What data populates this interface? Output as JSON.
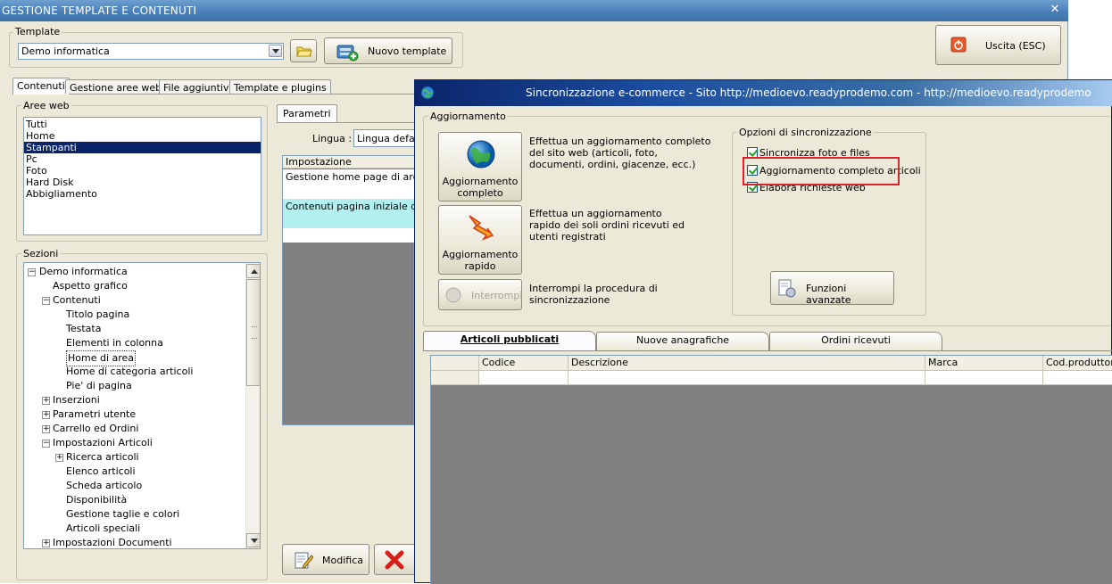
{
  "main_window": {
    "title": "GESTIONE TEMPLATE E CONTENUTI",
    "close_glyph": "✕"
  },
  "template_group": {
    "legend": "Template",
    "selected_template": "Demo informatica",
    "new_template_label": "Nuovo template"
  },
  "exit_button": {
    "label": "Uscita (ESC)"
  },
  "main_tabs": [
    "Contenuti",
    "Gestione aree web",
    "File aggiuntivi",
    "Template e plugins"
  ],
  "aree_web": {
    "legend": "Aree web",
    "items": [
      "Tutti",
      "Home",
      "Stampanti",
      "Pc",
      "Foto",
      "Hard Disk",
      "Abbigliamento"
    ],
    "selected": "Stampanti"
  },
  "sezioni": {
    "legend": "Sezioni",
    "tree": [
      {
        "label": "Demo informatica",
        "level": 0,
        "expander": "−"
      },
      {
        "label": "Aspetto grafico",
        "level": 1,
        "expander": ""
      },
      {
        "label": "Contenuti",
        "level": 1,
        "expander": "−"
      },
      {
        "label": "Titolo pagina",
        "level": 2,
        "expander": ""
      },
      {
        "label": "Testata",
        "level": 2,
        "expander": ""
      },
      {
        "label": "Elementi in colonna",
        "level": 2,
        "expander": ""
      },
      {
        "label": "Home di area",
        "level": 2,
        "expander": "",
        "selected": true
      },
      {
        "label": "Home di categoria articoli",
        "level": 2,
        "expander": ""
      },
      {
        "label": "Pie' di pagina",
        "level": 2,
        "expander": ""
      },
      {
        "label": "Inserzioni",
        "level": 1,
        "expander": "+"
      },
      {
        "label": "Parametri utente",
        "level": 1,
        "expander": "+"
      },
      {
        "label": "Carrello ed Ordini",
        "level": 1,
        "expander": "+"
      },
      {
        "label": "Impostazioni Articoli",
        "level": 1,
        "expander": "−"
      },
      {
        "label": "Ricerca articoli",
        "level": 2,
        "expander": "+"
      },
      {
        "label": "Elenco articoli",
        "level": 2,
        "expander": ""
      },
      {
        "label": "Scheda articolo",
        "level": 2,
        "expander": ""
      },
      {
        "label": "Disponibilità",
        "level": 2,
        "expander": ""
      },
      {
        "label": "Gestione taglie e colori",
        "level": 2,
        "expander": ""
      },
      {
        "label": "Articoli speciali",
        "level": 2,
        "expander": ""
      },
      {
        "label": "Impostazioni Documenti",
        "level": 1,
        "expander": "+"
      }
    ]
  },
  "parametri": {
    "tab_label": "Parametri",
    "lingua_label": "Lingua :",
    "lingua_value": "Lingua defau",
    "grid_header": "Impostazione",
    "rows": [
      "Gestione home page di area",
      "Contenuti pagina iniziale di are"
    ]
  },
  "bottom_buttons": {
    "modifica_label": "Modifica"
  },
  "sync_dialog": {
    "title": "Sincronizzazione e-commerce - Sito http://medioevo.readyprodemo.com - http://medioevo.readyprodemo",
    "aggiornamento_legend": "Aggiornamento",
    "btn_completo": [
      "Aggiornamento",
      "completo"
    ],
    "desc_completo": [
      "Effettua un aggiornamento completo",
      "del sito web (articoli, foto,",
      "documenti, ordini, giacenze, ecc.)"
    ],
    "btn_rapido": [
      "Aggiornamento",
      "rapido"
    ],
    "desc_rapido": [
      "Effettua un aggiornamento",
      "rapido dei soli ordini ricevuti ed",
      "utenti registrati"
    ],
    "btn_interrompi": "Interrompi",
    "desc_interrompi": [
      "Interrompi la procedura di",
      "sincronizzazione"
    ],
    "options_legend": "Opzioni di sincronizzazione",
    "options": [
      "Sincronizza foto e files",
      "Aggiornamento completo articoli",
      "Elabora richieste web"
    ],
    "funzioni_avanzate": "Funzioni avanzate",
    "highlight_color": "#e0202a",
    "tabs": [
      "Articoli pubblicati",
      "Nuove anagrafiche",
      "Ordini ricevuti"
    ],
    "grid_columns": [
      "Codice",
      "Descrizione",
      "Marca",
      "Cod.produttore"
    ]
  }
}
